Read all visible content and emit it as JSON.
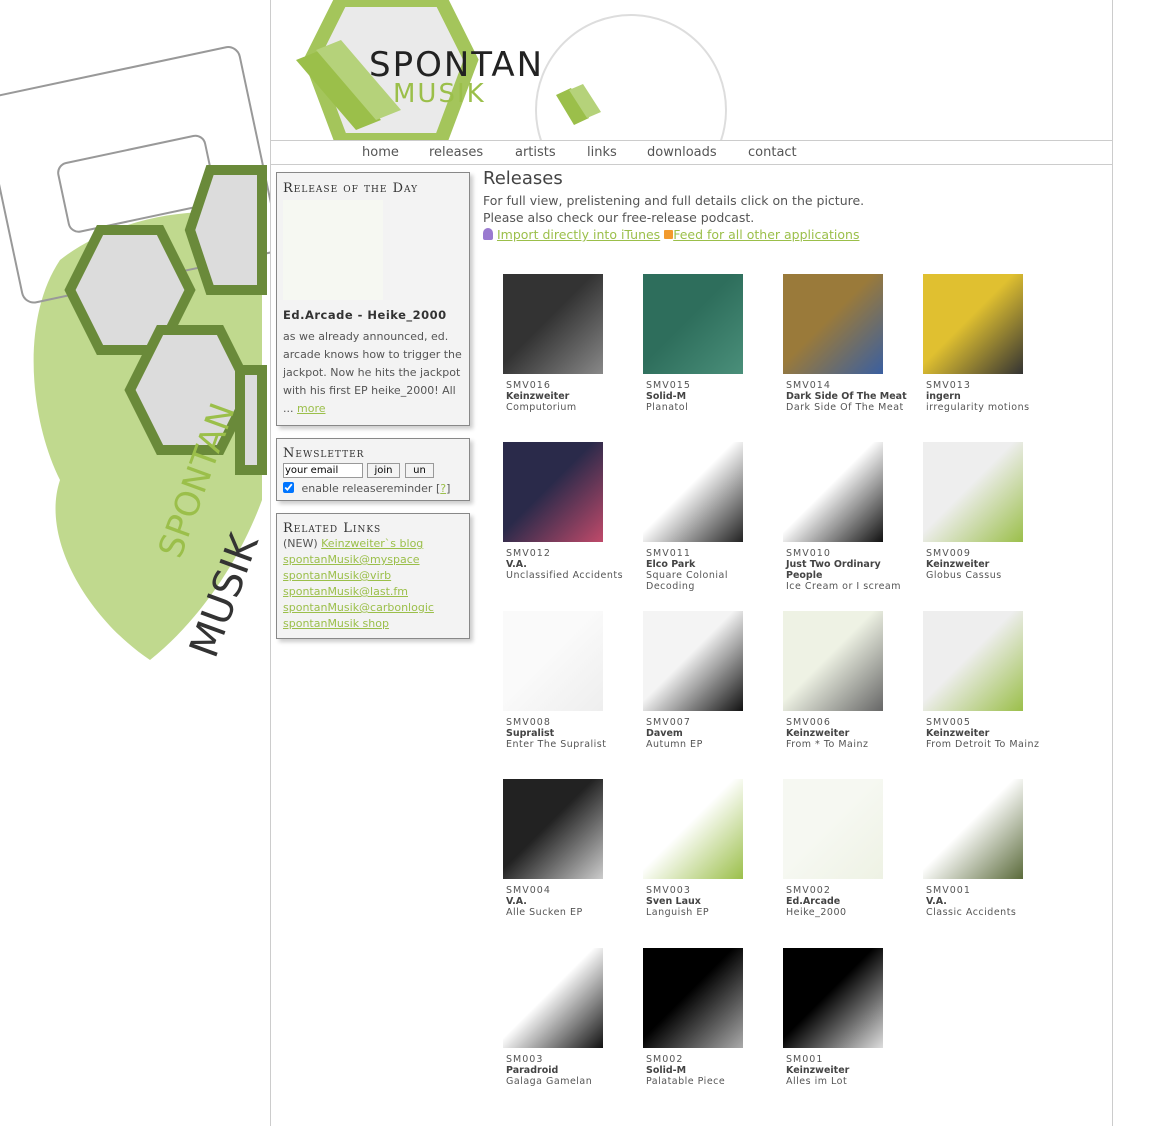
{
  "nav": [
    "home",
    "releases",
    "artists",
    "links",
    "downloads",
    "contact"
  ],
  "brand": {
    "line1": "SPONTAN",
    "line2": "MUSIK"
  },
  "rotd": {
    "heading": "Release of the Day",
    "title": "Ed.Arcade - Heike_2000",
    "text": "as we already announced, ed. arcade knows how to trigger the jackpot. Now he hits the jackpot with his first EP heike_2000! All ...",
    "more": "more"
  },
  "newsletter": {
    "heading": "Newsletter",
    "email_value": "your email",
    "join": "join",
    "un": "un",
    "reminder": "enable releasereminder",
    "help_open": "[",
    "help": "?",
    "help_close": "]"
  },
  "related": {
    "heading": "Related Links",
    "new_label": "(NEW)",
    "links": [
      "Keinzweiter`s blog",
      "spontanMusik@myspace",
      "spontanMusik@virb",
      "spontanMusik@last.fm",
      "spontanMusik@carbonlogic",
      "spontanMusik shop"
    ]
  },
  "main": {
    "title": "Releases",
    "intro1": "For full view, prelistening and full details click on the picture.",
    "intro2": "Please also check our free-release podcast.",
    "itunes": "Import directly into iTunes",
    "feed": "Feed for all other applications"
  },
  "releases": [
    {
      "cat": "SMV016",
      "artist": "Keinzweiter",
      "title": "Computorium",
      "c1": "#333",
      "c2": "#888"
    },
    {
      "cat": "SMV015",
      "artist": "Solid-M",
      "title": "Planatol",
      "c1": "#2e6e5c",
      "c2": "#4a8f7a"
    },
    {
      "cat": "SMV014",
      "artist": "Dark Side Of The Meat",
      "title": "Dark Side Of The Meat",
      "c1": "#9a7a3a",
      "c2": "#3a5fa0"
    },
    {
      "cat": "SMV013",
      "artist": "ingern",
      "title": "irregularity motions",
      "c1": "#e0c030",
      "c2": "#333"
    },
    {
      "cat": "SMV012",
      "artist": "V.A.",
      "title": "Unclassified Accidents",
      "c1": "#2a2a4a",
      "c2": "#c04a6a"
    },
    {
      "cat": "SMV011",
      "artist": "Elco Park",
      "title": "Square Colonial Decoding",
      "c1": "#fff",
      "c2": "#222"
    },
    {
      "cat": "SMV010",
      "artist": "Just Two Ordinary People",
      "title": "Ice Cream or I scream",
      "c1": "#fff",
      "c2": "#111"
    },
    {
      "cat": "SMV009",
      "artist": "Keinzweiter",
      "title": "Globus Cassus",
      "c1": "#eee",
      "c2": "#9bbf4a"
    },
    {
      "cat": "SMV008",
      "artist": "Supralist",
      "title": "Enter The Supralist",
      "c1": "#fafafa",
      "c2": "#eee"
    },
    {
      "cat": "SMV007",
      "artist": "Davem",
      "title": "Autumn EP",
      "c1": "#f4f4f4",
      "c2": "#111"
    },
    {
      "cat": "SMV006",
      "artist": "Keinzweiter",
      "title": "From * To Mainz",
      "c1": "#eef2e4",
      "c2": "#666"
    },
    {
      "cat": "SMV005",
      "artist": "Keinzweiter",
      "title": "From Detroit To Mainz",
      "c1": "#eee",
      "c2": "#9bbf4a"
    },
    {
      "cat": "SMV004",
      "artist": "V.A.",
      "title": "Alle Sucken EP",
      "c1": "#222",
      "c2": "#ccc"
    },
    {
      "cat": "SMV003",
      "artist": "Sven Laux",
      "title": "Languish EP",
      "c1": "#fff",
      "c2": "#9bbf4a"
    },
    {
      "cat": "SMV002",
      "artist": "Ed.Arcade",
      "title": "Heike_2000",
      "c1": "#f6f8f2",
      "c2": "#eef2e4"
    },
    {
      "cat": "SMV001",
      "artist": "V.A.",
      "title": "Classic Accidents",
      "c1": "#fff",
      "c2": "#5a6a3a"
    },
    {
      "cat": "SM003",
      "artist": "Paradroid",
      "title": "Galaga Gamelan",
      "c1": "#fff",
      "c2": "#111"
    },
    {
      "cat": "SM002",
      "artist": "Solid-M",
      "title": "Palatable Piece",
      "c1": "#000",
      "c2": "#aaa"
    },
    {
      "cat": "SM001",
      "artist": "Keinzweiter",
      "title": "Alles im Lot",
      "c1": "#000",
      "c2": "#ddd"
    }
  ]
}
